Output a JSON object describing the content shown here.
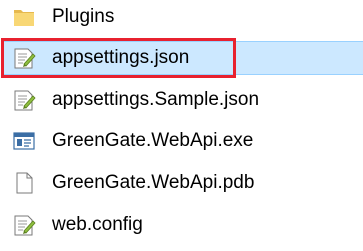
{
  "files": [
    {
      "name": "Plugins",
      "icon": "folder-icon",
      "selected": false
    },
    {
      "name": "appsettings.json",
      "icon": "json-file-icon",
      "selected": true
    },
    {
      "name": "appsettings.Sample.json",
      "icon": "json-file-icon",
      "selected": false
    },
    {
      "name": "GreenGate.WebApi.exe",
      "icon": "exe-file-icon",
      "selected": false
    },
    {
      "name": "GreenGate.WebApi.pdb",
      "icon": "blank-file-icon",
      "selected": false
    },
    {
      "name": "web.config",
      "icon": "config-file-icon",
      "selected": false
    }
  ],
  "colors": {
    "selection_background": "#cce8ff",
    "selection_border": "#99d1ff",
    "highlight_box": "#e8212f",
    "folder": "#f8d775"
  }
}
